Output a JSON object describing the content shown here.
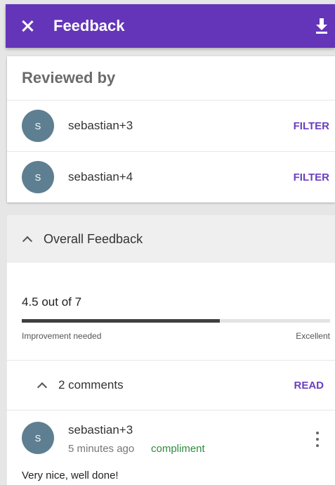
{
  "app_bar": {
    "title": "Feedback",
    "close_icon": "close-icon",
    "download_icon": "download-icon",
    "color": "#6435b8"
  },
  "reviewed": {
    "heading": "Reviewed by",
    "reviewers": [
      {
        "initial": "S",
        "name": "sebastian+3",
        "action": "FILTER"
      },
      {
        "initial": "S",
        "name": "sebastian+4",
        "action": "FILTER"
      }
    ]
  },
  "overall": {
    "header": "Overall Feedback",
    "score_text": "4.5 out of 7",
    "score_fraction": 0.643,
    "scale_low": "Improvement needed",
    "scale_high": "Excellent"
  },
  "comments": {
    "count_label": "2 comments",
    "read_label": "READ",
    "items": [
      {
        "initial": "S",
        "author": "sebastian+3",
        "time": "5 minutes ago",
        "tag": "compliment",
        "body": "Very nice, well done!"
      }
    ]
  },
  "colors": {
    "accent": "#6a3fc0",
    "compliment": "#2e8b3e",
    "avatar": "#5e7f91"
  }
}
